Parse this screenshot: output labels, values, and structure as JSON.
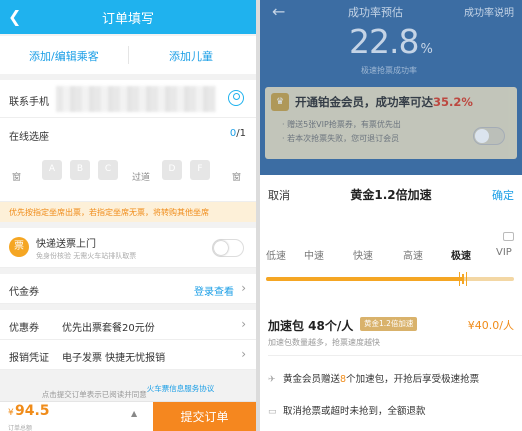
{
  "left": {
    "header": {
      "back_icon": "chevron-left-icon",
      "title": "订单填写"
    },
    "add_passenger": "添加/编辑乘客",
    "add_child": "添加儿童",
    "phone": {
      "label": "联系手机",
      "icon": "person-icon"
    },
    "seat": {
      "label": "在线选座",
      "count_selected": "0",
      "count_total": "/1",
      "window_left": "窗",
      "seats_left": [
        "A",
        "B",
        "C"
      ],
      "aisle": "过道",
      "seats_right": [
        "D",
        "F"
      ],
      "window_right": "窗"
    },
    "notice": "优先按指定坐席出票，若指定坐席无票，将转购其他坐席",
    "fast_delivery": {
      "icon": "ticket-icon",
      "title": "快递送票上门",
      "subtitle": "免身份核验 无需火车站排队取票"
    },
    "voucher": {
      "label": "代金券",
      "action": "登录查看"
    },
    "coupon": {
      "label": "优惠券",
      "value": "优先出票套餐20元份"
    },
    "receipt": {
      "label": "报销凭证",
      "value": "电子发票 快捷无忧报销"
    },
    "agreement": {
      "prefix": "点击提交订单表示已阅读并同意",
      "link": "火车票信息服务协议"
    },
    "footer": {
      "currency": "¥",
      "price": "94.5",
      "sub": "订单总额",
      "submit": "提交订单"
    }
  },
  "right": {
    "back_icon": "arrow-left-icon",
    "title": "成功率预估",
    "explain": "成功率说明",
    "rate": "22.8",
    "rate_unit": "%",
    "rate_caption": "极速抢票成功率",
    "vip": {
      "crown_icon": "crown-icon",
      "headline": "开通铂金会员，成功率可达",
      "headline_value": "35.2%",
      "bullet1": "赠送5张VIP抢票券，有票优先出",
      "bullet2": "若本次抢票失败，您可退订会员"
    },
    "sheet": {
      "cancel": "取消",
      "title": "黄金1.2倍加速",
      "confirm": "确定",
      "speeds": [
        "低速",
        "中速",
        "快速",
        "高速",
        "极速",
        "VIP"
      ],
      "active_speed": "极速",
      "slider_level": 0.8,
      "package_title": "加速包 48个/人",
      "package_badge": "黄金1.2倍加速",
      "package_price": "¥40.0/人",
      "package_sub": "加速包数量越多，抢票速度越快",
      "feature1_prefix": "黄金会员赠送",
      "feature1_num": "8",
      "feature1_suffix": "个加速包，开抢后享受极速抢票",
      "feature2": "取消抢票或超时未抢到，全额退款"
    }
  },
  "colors": {
    "primary_blue": "#1fb2ee",
    "accent_orange": "#f5871f",
    "dim_blue": "#3c6da3",
    "gold": "#d9b26b"
  }
}
